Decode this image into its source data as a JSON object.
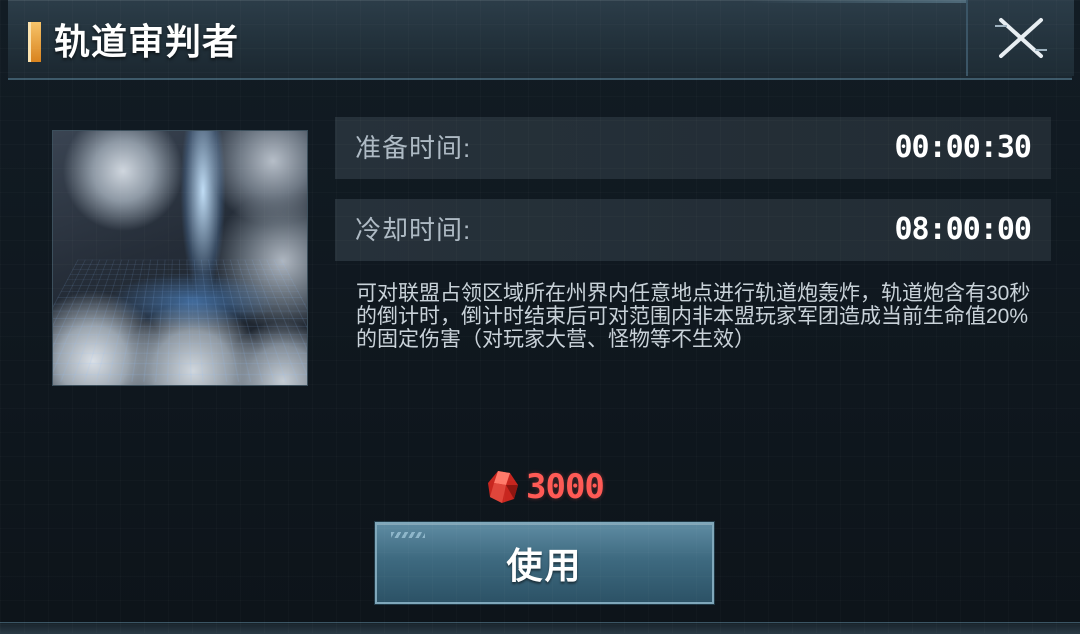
{
  "header": {
    "title": "轨道审判者",
    "close_icon": "close-x-icon",
    "accent_color": "#e39a2e"
  },
  "skill": {
    "image": "orbital-strike-artwork",
    "prep_label": "准备时间:",
    "prep_value": "00:00:30",
    "cooldown_label": "冷却时间:",
    "cooldown_value": "08:00:00",
    "description": "可对联盟占领区域所在州界内任意地点进行轨道炮轰炸，轨道炮含有30秒的倒计时，倒计时结束后可对范围内非本盟玩家军团造成当前生命值20%的固定伤害（对玩家大营、怪物等不生效）"
  },
  "cost": {
    "icon": "red-crystal-icon",
    "amount": "3000",
    "color": "#ff5a55"
  },
  "actions": {
    "use_label": "使用"
  }
}
